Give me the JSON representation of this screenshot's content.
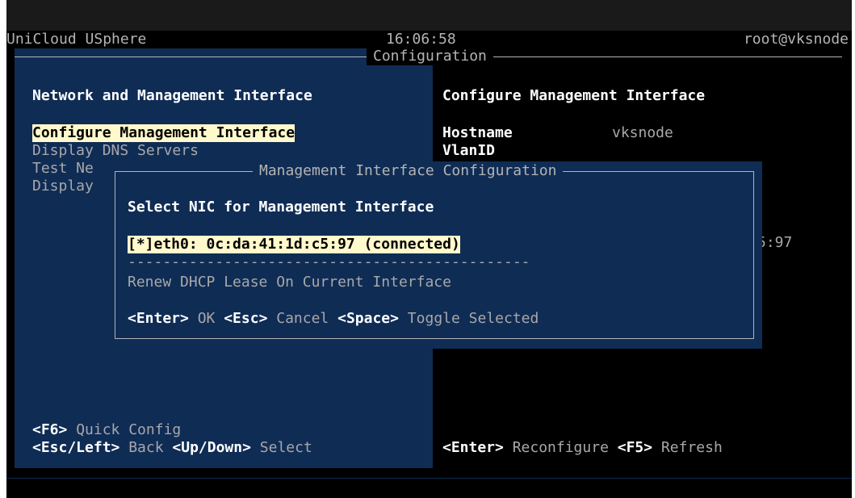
{
  "header": {
    "app_title": "UniCloud USphere",
    "clock": "16:06:58",
    "user_host": "root@vksnode",
    "frame_title": "Configuration"
  },
  "left_panel": {
    "heading": "Network and Management Interface",
    "menu": [
      {
        "label": "Configure Management Interface",
        "selected": true
      },
      {
        "label": "Display DNS Servers",
        "selected": false
      },
      {
        "label": "Test Ne",
        "selected": false
      },
      {
        "label": "Display",
        "selected": false
      }
    ],
    "footer_line1_key": "<F6>",
    "footer_line1_text": " Quick Config",
    "footer_line2_key1": "<Esc/Left>",
    "footer_line2_text1": " Back ",
    "footer_line2_key2": "<Up/Down>",
    "footer_line2_text2": " Select"
  },
  "right_panel": {
    "heading": "Configure Management Interface",
    "hostname_label": "Hostname",
    "hostname_value": "vksnode",
    "vlan_label": "VlanID",
    "mac_fragment": "5:97",
    "footer_key1": "<Enter>",
    "footer_text1": " Reconfigure ",
    "footer_key2": "<F5>",
    "footer_text2": " Refresh"
  },
  "dialog": {
    "title": "Management Interface Configuration",
    "prompt": "Select NIC for Management Interface",
    "nic_option": "[*]eth0: 0c:da:41:1d:c5:97 (connected)",
    "separator": "----------------------------------------------",
    "renew_option": "Renew DHCP Lease On Current Interface",
    "key_enter": "<Enter>",
    "text_ok": " OK ",
    "key_esc": "<Esc>",
    "text_cancel": " Cancel ",
    "key_space": "<Space>",
    "text_toggle": " Toggle Selected"
  },
  "colors": {
    "panel_blue": "#0f2c55",
    "highlight": "#fff9cc",
    "text_grey": "#a8a8a8",
    "text_white": "#ffffff"
  }
}
